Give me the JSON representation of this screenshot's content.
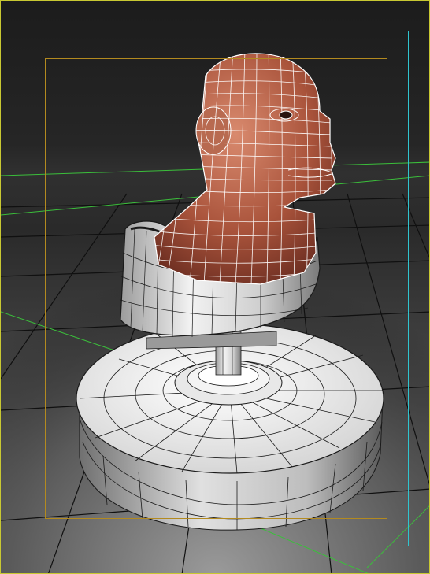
{
  "viewport": {
    "frame_color": "#c8c832",
    "action_safe_color": "#2fc4cf",
    "title_safe_color": "#b38a1f",
    "home_grid_color": "#3bbf3b",
    "floor_grid_color": "#101010"
  },
  "model": {
    "skin_color": "#b35f45",
    "wireframe_color": "#ffffff",
    "pedestal_color": "#d8d8d8",
    "edge_color": "#1a1a1a"
  }
}
